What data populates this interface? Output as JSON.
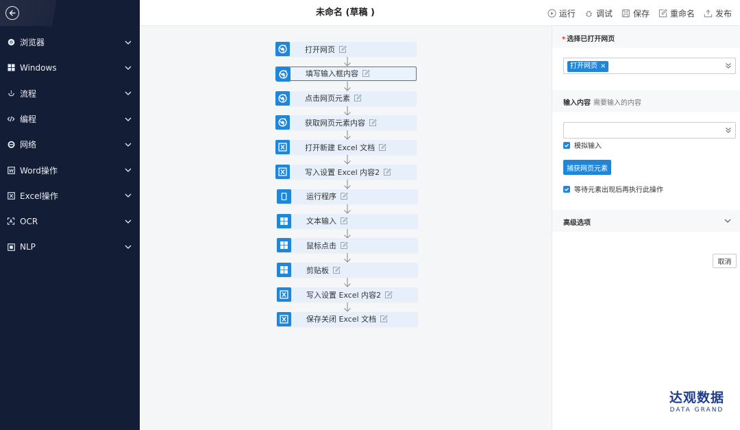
{
  "app": {
    "title": "未命名 (草稿 )"
  },
  "header": {
    "actions": [
      {
        "label": "运行",
        "icon": "play-icon"
      },
      {
        "label": "调试",
        "icon": "bug-icon"
      },
      {
        "label": "保存",
        "icon": "save-icon"
      },
      {
        "label": "重命名",
        "icon": "edit-icon"
      },
      {
        "label": "发布",
        "icon": "upload-icon"
      }
    ]
  },
  "sidebar": {
    "items": [
      {
        "label": "浏览器",
        "icon": "chrome-icon"
      },
      {
        "label": "Windows",
        "icon": "windows-icon"
      },
      {
        "label": "流程",
        "icon": "flow-icon"
      },
      {
        "label": "编程",
        "icon": "code-icon"
      },
      {
        "label": "网络",
        "icon": "ie-icon"
      },
      {
        "label": "Word操作",
        "icon": "word-icon"
      },
      {
        "label": "Excel操作",
        "icon": "excel-icon"
      },
      {
        "label": "OCR",
        "icon": "ocr-icon"
      },
      {
        "label": "NLP",
        "icon": "nlp-icon"
      }
    ]
  },
  "flow": {
    "nodes": [
      {
        "label": "打开网页",
        "icon": "chrome-icon"
      },
      {
        "label": "填写输入框内容",
        "icon": "chrome-icon",
        "selected": true
      },
      {
        "label": "点击网页元素",
        "icon": "chrome-icon"
      },
      {
        "label": "获取网页元素内容",
        "icon": "chrome-icon"
      },
      {
        "label": "打开新建 Excel 文档",
        "icon": "excel-icon"
      },
      {
        "label": "写入设置 Excel 内容2",
        "icon": "excel-icon"
      },
      {
        "label": "运行程序",
        "icon": "program-icon"
      },
      {
        "label": "文本输入",
        "icon": "windows-icon"
      },
      {
        "label": "鼠标点击",
        "icon": "windows-icon"
      },
      {
        "label": "剪贴板",
        "icon": "windows-icon"
      },
      {
        "label": "写入设置 Excel 内容2",
        "icon": "excel-icon"
      },
      {
        "label": "保存关闭 Excel 文档",
        "icon": "excel-icon"
      }
    ]
  },
  "panel": {
    "select_page_label": "选择已打开网页",
    "required_mark": "*",
    "selected_tag": "打开网页",
    "tag_close": "×",
    "input_label": "输入内容",
    "input_hint": "需要输入的内容",
    "simulate_label": "模拟输入",
    "capture_button": "捕获网页元素",
    "wait_label": "等待元素出现后再执行此操作",
    "advanced_label": "高级选项",
    "cancel_button": "取消"
  },
  "brand": {
    "name": "达观数据",
    "sub": "DATA GRAND"
  },
  "colors": {
    "sidebar_bg": "#141d36",
    "accent": "#1f86d9",
    "node_bg": "#e7f0fa",
    "brand": "#1d3c8a"
  }
}
